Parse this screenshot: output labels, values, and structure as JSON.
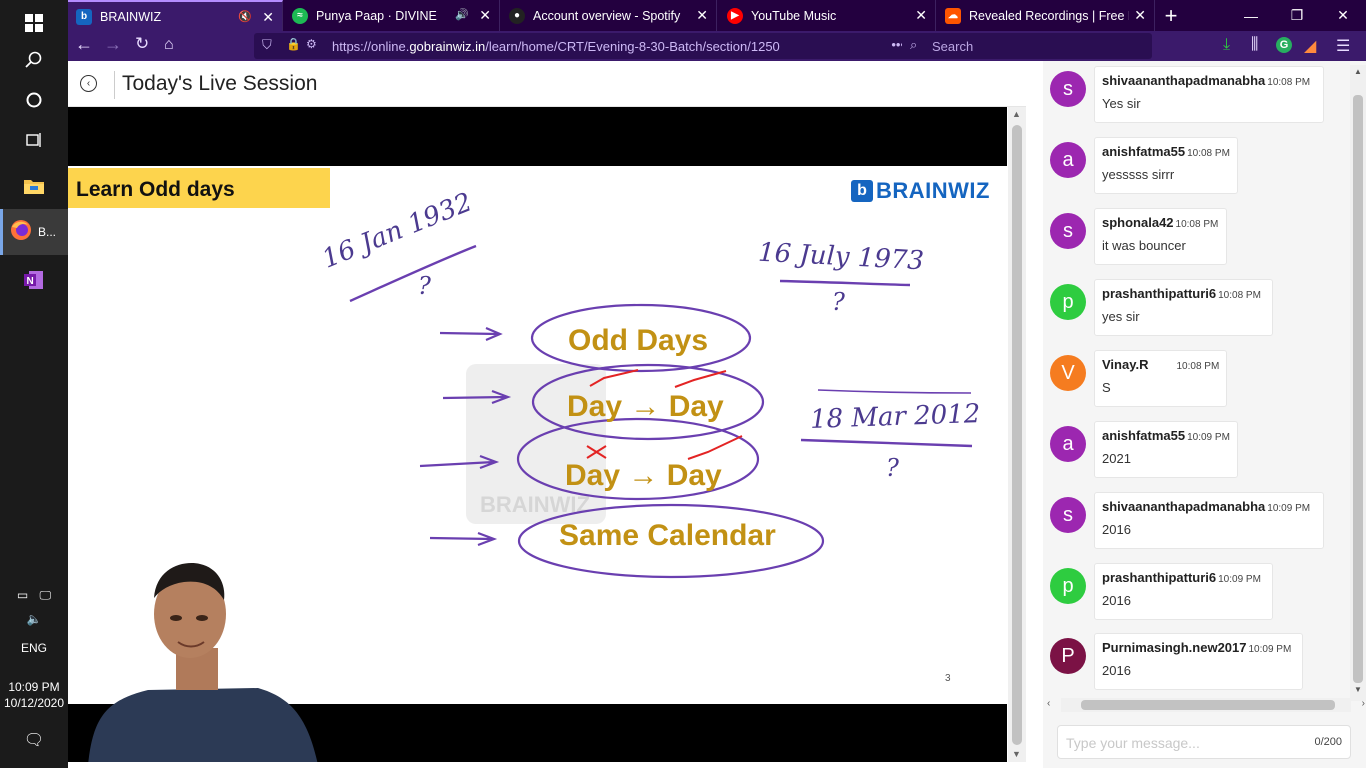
{
  "browser": {
    "tabs": [
      {
        "title": "BRAINWIZ",
        "active": true,
        "icon": "brainwiz-favicon",
        "favcolor": "#1565c0",
        "favtext": "b"
      },
      {
        "title": "Punya Paap · DIVINE",
        "active": false,
        "icon": "spotify-favicon",
        "favcolor": "#1db954",
        "favtext": "≈"
      },
      {
        "title": "Account overview - Spotify",
        "active": false,
        "icon": "spotify-dark-favicon",
        "favcolor": "#222222",
        "favtext": "●"
      },
      {
        "title": "YouTube Music",
        "active": false,
        "icon": "youtube-music-favicon",
        "favcolor": "#ff0000",
        "favtext": "▶"
      },
      {
        "title": "Revealed Recordings | Free Lis",
        "active": false,
        "icon": "soundcloud-favicon",
        "favcolor": "#ff5500",
        "favtext": "☁"
      }
    ],
    "url_prefix": "https://online.",
    "url_domain": "gobrainwiz.in",
    "url_path": "/learn/home/CRT/Evening-8-30-Batch/section/1250",
    "search_placeholder": "Search"
  },
  "taskbar": {
    "firefox_label": "B...",
    "language": "ENG",
    "time": "10:09 PM",
    "date": "10/12/2020"
  },
  "header": {
    "title": "Today's Live Session"
  },
  "slide": {
    "title": "Learn Odd days",
    "brand": "BRAINWIZ",
    "topics": [
      "Odd Days",
      "Day → Day",
      "Day → Day",
      "Same Calendar"
    ],
    "handwritten": {
      "date1": "16 Jan 1932",
      "date2": "16 July 1973",
      "date3": "18 Mar 2012",
      "question": "?"
    },
    "page_number": "3"
  },
  "chat": {
    "messages": [
      {
        "initial": "s",
        "user": "shivaananthapadmanabha",
        "time": "10:08 PM",
        "text": "Yes sir",
        "color": "#9c27b0"
      },
      {
        "initial": "a",
        "user": "anishfatma55",
        "time": "10:08 PM",
        "text": "yesssss sirrr",
        "color": "#9c27b0"
      },
      {
        "initial": "s",
        "user": "sphonala42",
        "time": "10:08 PM",
        "text": "it was bouncer",
        "color": "#9c27b0"
      },
      {
        "initial": "p",
        "user": "prashanthipatturi6",
        "time": "10:08 PM",
        "text": "yes sir",
        "color": "#2ecc40"
      },
      {
        "initial": "V",
        "user": "Vinay.R",
        "time": "10:08 PM",
        "text": "S",
        "color": "#f57c20"
      },
      {
        "initial": "a",
        "user": "anishfatma55",
        "time": "10:09 PM",
        "text": "2021",
        "color": "#9c27b0"
      },
      {
        "initial": "s",
        "user": "shivaananthapadmanabha",
        "time": "10:09 PM",
        "text": "2016",
        "color": "#9c27b0"
      },
      {
        "initial": "p",
        "user": "prashanthipatturi6",
        "time": "10:09 PM",
        "text": "2016",
        "color": "#2ecc40"
      },
      {
        "initial": "P",
        "user": "Purnimasingh.new2017",
        "time": "10:09 PM",
        "text": "2016",
        "color": "#7b1245"
      }
    ],
    "input_placeholder": "Type your message...",
    "char_count": "0/200"
  }
}
